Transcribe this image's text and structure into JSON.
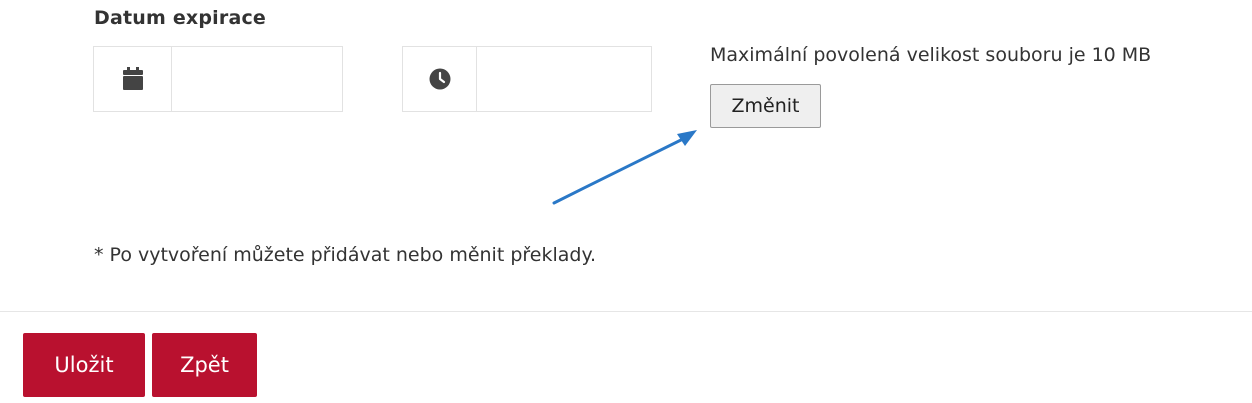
{
  "expiration": {
    "label": "Datum expirace",
    "date_value": "",
    "time_value": "",
    "date_icon": "calendar-icon",
    "time_icon": "clock-icon"
  },
  "upload": {
    "max_size_note": "Maximální povolená velikost souboru je 10 MB",
    "change_label": "Změnit"
  },
  "footnote": "* Po vytvoření můžete přidávat nebo měnit překlady.",
  "actions": {
    "save_label": "Uložit",
    "back_label": "Zpět"
  },
  "colors": {
    "primary_button": "#b9112f",
    "annotation_arrow": "#2a78c7",
    "text": "#333333"
  }
}
